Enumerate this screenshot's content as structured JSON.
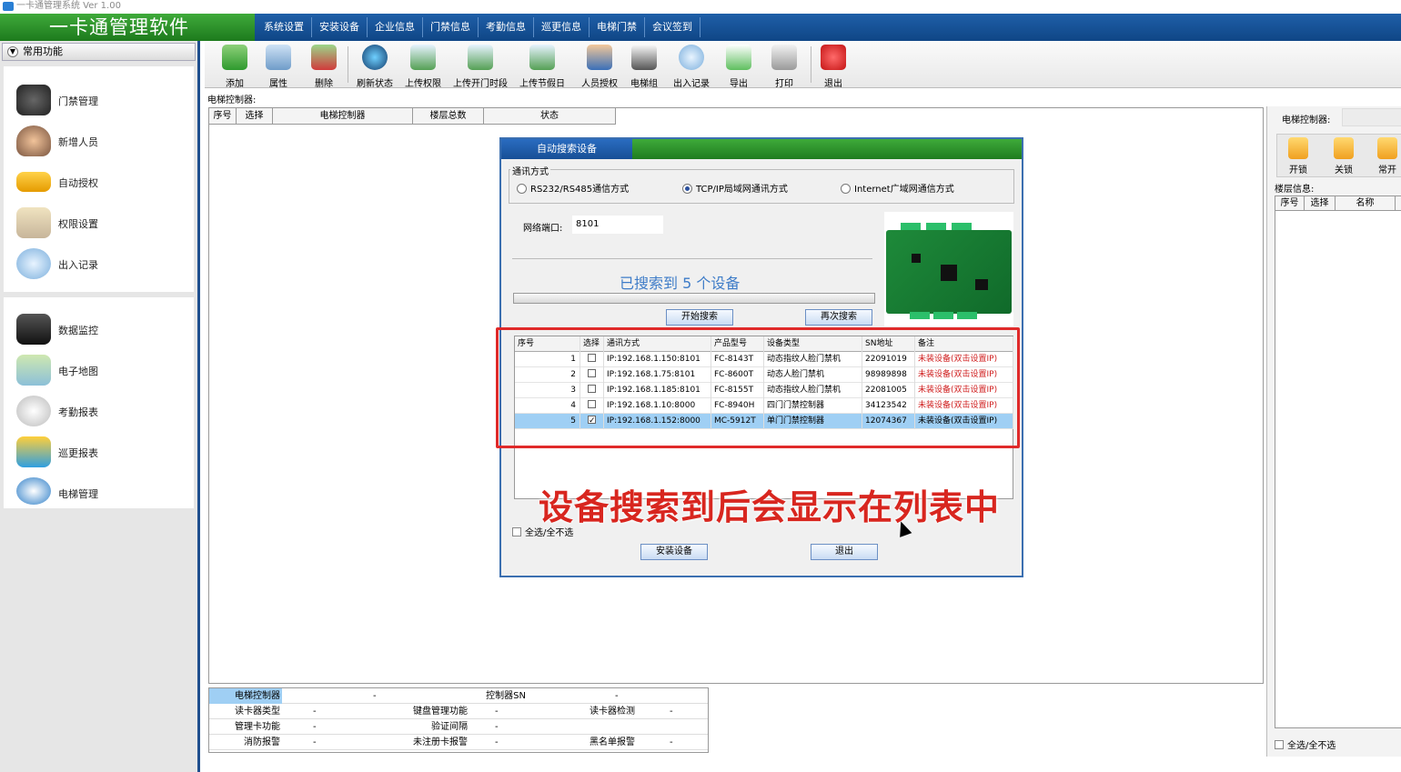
{
  "window": {
    "title": "一卡通管理系统  Ver 1.00"
  },
  "brand": "一卡通管理软件",
  "menu": [
    "系统设置",
    "安装设备",
    "企业信息",
    "门禁信息",
    "考勤信息",
    "巡更信息",
    "电梯门禁",
    "会议签到"
  ],
  "sidebar": {
    "header": "常用功能",
    "group1": [
      "门禁管理",
      "新增人员",
      "自动授权",
      "权限设置",
      "出入记录"
    ],
    "group2": [
      "数据监控",
      "电子地图",
      "考勤报表",
      "巡更报表",
      "电梯管理"
    ]
  },
  "toolbar": [
    "添加",
    "属性",
    "删除",
    "刷新状态",
    "上传权限",
    "上传开门时段",
    "上传节假日",
    "人员授权",
    "电梯组",
    "出入记录",
    "导出",
    "打印",
    "退出"
  ],
  "main": {
    "ctrl_label": "电梯控制器:",
    "grid_headers": [
      "序号",
      "选择",
      "电梯控制器",
      "楼层总数",
      "状态"
    ]
  },
  "info": {
    "rows": [
      [
        "电梯控制器",
        "-",
        "控制器SN",
        "-"
      ],
      [
        "读卡器类型",
        "-",
        "键盘管理功能",
        "-",
        "读卡器检测",
        "-"
      ],
      [
        "管理卡功能",
        "-",
        "验证间隔",
        "-"
      ],
      [
        "消防报警",
        "-",
        "未注册卡报警",
        "-",
        "黑名单报警",
        "-"
      ]
    ]
  },
  "right": {
    "title": "电梯控制器:",
    "buttons": [
      "开锁",
      "关锁",
      "常开"
    ],
    "floor_label": "楼层信息:",
    "grid_headers": [
      "序号",
      "选择",
      "名称"
    ],
    "select_all": "全选/全不选"
  },
  "dialog": {
    "title": "自动搜索设备",
    "comm_legend": "通讯方式",
    "radios": [
      "RS232/RS485通信方式",
      "TCP/IP局域网通讯方式",
      "Internet广域网通信方式"
    ],
    "selected_radio": 1,
    "port_label": "网络端口:",
    "port_value": "8101",
    "found_text": "已搜索到  5 个设备",
    "start_button": "开始搜索",
    "research_button": "再次搜索",
    "table_headers": [
      "序号",
      "选择",
      "通讯方式",
      "产品型号",
      "设备类型",
      "SN地址",
      "备注"
    ],
    "rows": [
      {
        "no": "1",
        "checked": false,
        "comm": "IP:192.168.1.150:8101",
        "model": "FC-8143T",
        "type": "动态指纹人脸门禁机",
        "sn": "22091019",
        "note": "未装设备(双击设置IP)"
      },
      {
        "no": "2",
        "checked": false,
        "comm": "IP:192.168.1.75:8101",
        "model": "FC-8600T",
        "type": "动态人脸门禁机",
        "sn": "98989898",
        "note": "未装设备(双击设置IP)"
      },
      {
        "no": "3",
        "checked": false,
        "comm": "IP:192.168.1.185:8101",
        "model": "FC-8155T",
        "type": "动态指纹人脸门禁机",
        "sn": "22081005",
        "note": "未装设备(双击设置IP)"
      },
      {
        "no": "4",
        "checked": false,
        "comm": "IP:192.168.1.10:8000",
        "model": "FC-8940H",
        "type": "四门门禁控制器",
        "sn": "34123542",
        "note": "未装设备(双击设置IP)"
      },
      {
        "no": "5",
        "checked": true,
        "comm": "IP:192.168.1.152:8000",
        "model": "MC-5912T",
        "type": "单门门禁控制器",
        "sn": "12074367",
        "note": "未装设备(双击设置IP)"
      }
    ],
    "selected_row": 4,
    "select_all": "全选/全不选",
    "install_button": "安装设备",
    "exit_button": "退出"
  },
  "annotation": "设备搜索到后会显示在列表中",
  "colors": {
    "menu_blue": "#1f5fa8",
    "brand_green": "#3faa3a",
    "highlight_red": "#e02a2a",
    "note_red": "#d02020",
    "selected_row": "#9fcff4"
  }
}
